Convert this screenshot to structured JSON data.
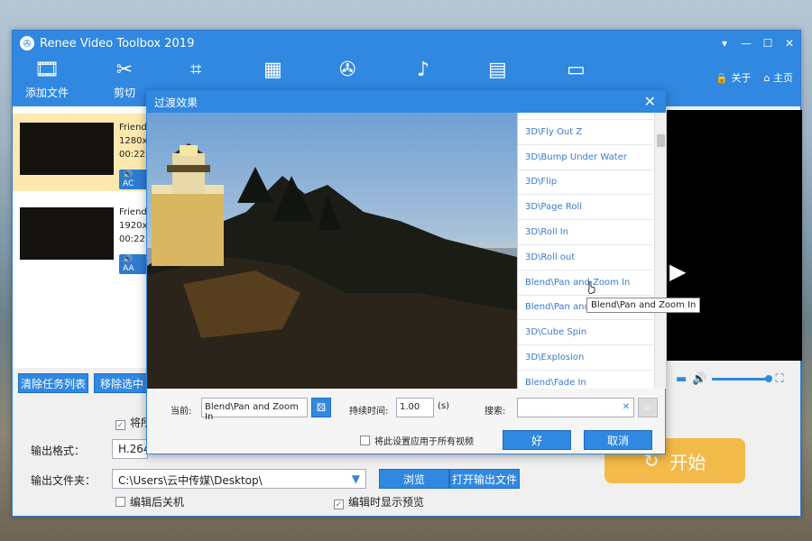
{
  "app": {
    "title": "Renee Video Toolbox 2019",
    "winctl": [
      "▾",
      "—",
      "☐",
      "✕"
    ]
  },
  "toolbar": {
    "tools": [
      {
        "icon": "add-file-icon",
        "glyph": "🎞",
        "label": "添加文件"
      },
      {
        "icon": "cut-icon",
        "glyph": "✂",
        "label": "剪切"
      },
      {
        "icon": "crop-icon",
        "glyph": "⌗",
        "label": ""
      },
      {
        "icon": "effects-icon",
        "glyph": "▦",
        "label": ""
      },
      {
        "icon": "film-reel-icon",
        "glyph": "✇",
        "label": ""
      },
      {
        "icon": "music-icon",
        "glyph": "♪",
        "label": ""
      },
      {
        "icon": "subtitle-icon",
        "glyph": "▤",
        "label": ""
      },
      {
        "icon": "watermark-icon",
        "glyph": "▭",
        "label": ""
      }
    ],
    "about": "关于",
    "home": "主页"
  },
  "files": [
    {
      "name": "Friend",
      "res": "1280x7",
      "dur": "00:22:",
      "audio": "AC"
    },
    {
      "name": "Friend",
      "res": "1920x1",
      "dur": "00:22:",
      "audio": "AA"
    }
  ],
  "buttons": {
    "clear": "清除任务列表",
    "remove": "移除选中",
    "browse": "浏览",
    "open_output": "打开输出文件",
    "start": "开始"
  },
  "lower": {
    "merge_label": "将所",
    "format_label": "输出格式：",
    "format_value": "H.264",
    "folder_label": "输出文件夹：",
    "folder_value": "C:\\Users\\云中传媒\\Desktop\\",
    "shutdown": "编辑后关机",
    "show_preview": "编辑时显示预览"
  },
  "dialog": {
    "title": "过渡效果",
    "effects": [
      "3D\\Fly Out Z",
      "3D\\Bump Under Water",
      "3D\\Flip",
      "3D\\Page Roll",
      "3D\\Roll In",
      "3D\\Roll out",
      "Blend\\Pan and Zoom In",
      "Blend\\Pan and",
      "3D\\Cube Spin",
      "3D\\Explosion",
      "Blend\\Fade In"
    ],
    "tooltip": "Blend\\Pan and Zoom In",
    "current_label": "当前:",
    "current_value": "Blend\\Pan and Zoom In",
    "duration_label": "持续时间:",
    "duration_value": "1.00",
    "duration_unit": "(s)",
    "search_label": "搜索:",
    "search_value": "",
    "apply_all": "将此设置应用于所有视频",
    "ok": "好",
    "cancel": "取消"
  }
}
